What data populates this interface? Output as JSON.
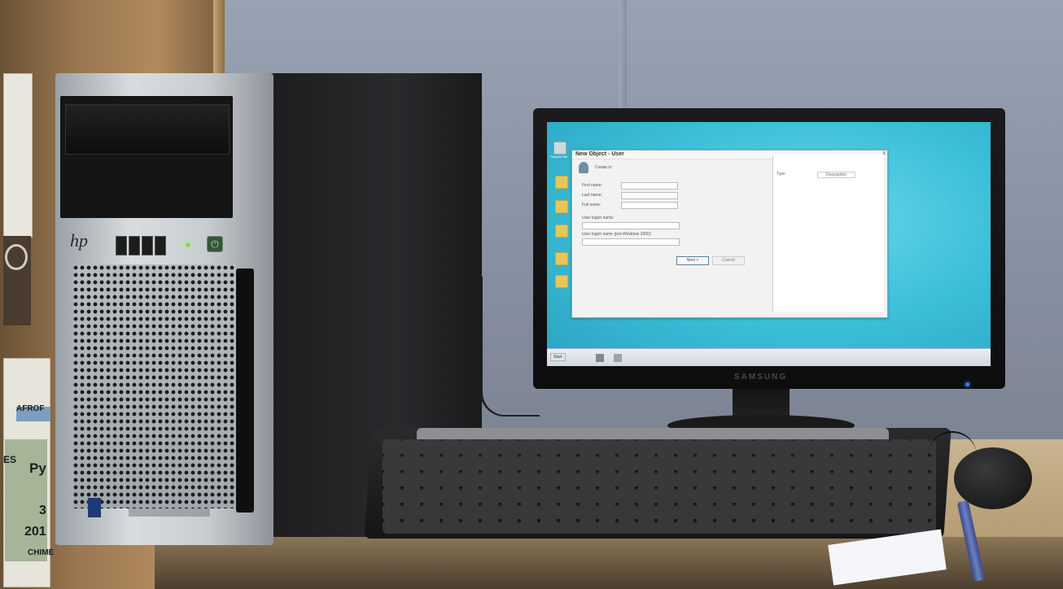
{
  "scene": {
    "colors": {
      "wall": "#8a94a5",
      "screen": "#3dbfd9",
      "desk": "#b79f77",
      "tower_front": "#c7ccd0"
    }
  },
  "shelf": {
    "spine_texts": [
      "AFROF",
      "ES",
      "Py",
      "3",
      "201",
      "CHIME"
    ]
  },
  "tower": {
    "brand": "hp",
    "power_symbol": "⏻"
  },
  "monitor": {
    "brand": "SAMSUNG",
    "desktop": {
      "icons": [
        {
          "name": "recycle-bin",
          "label": "Recycle Bin"
        }
      ],
      "dialog": {
        "title": "New Object - User",
        "close": "x",
        "create_in": "Create in:",
        "fields": [
          {
            "label": "First name:"
          },
          {
            "label": "Last name:"
          },
          {
            "label": "Full name:"
          },
          {
            "label": "User logon name:"
          },
          {
            "label": "User logon name (pre-Windows 2000):"
          }
        ],
        "buttons": {
          "next": "Next >",
          "cancel": "Cancel"
        },
        "side_panel": {
          "type": "Type",
          "description": "Description"
        }
      },
      "taskbar": {
        "start": "Start",
        "clock": ""
      }
    }
  }
}
